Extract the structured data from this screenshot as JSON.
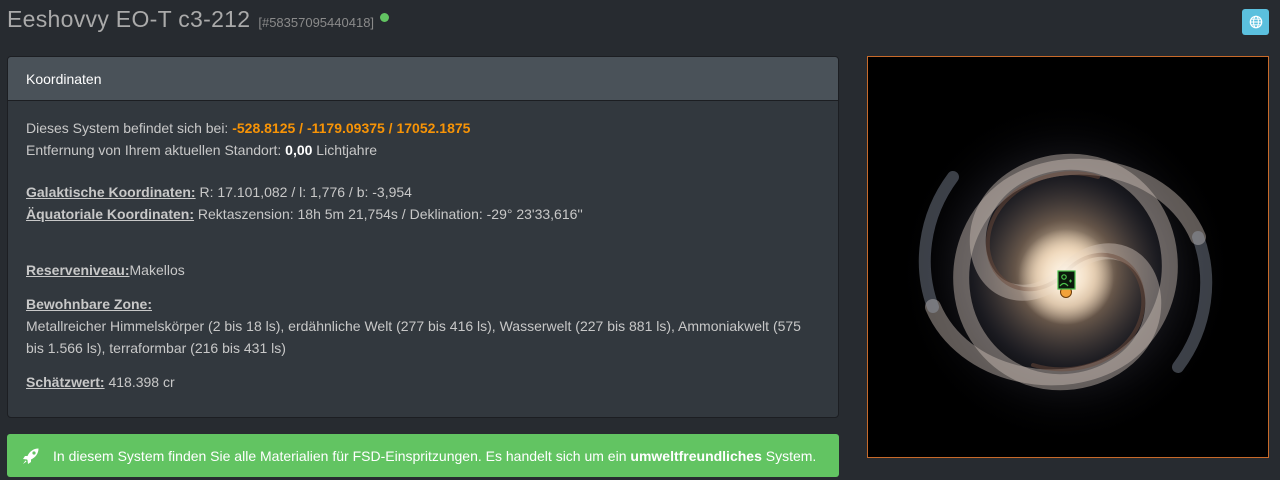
{
  "header": {
    "system_name": "Eeshovvy EO-T c3-212",
    "system_id": "[#58357095440418]",
    "status_color": "#62c462",
    "globe_icon": "globe-icon"
  },
  "panel": {
    "heading": "Koordinaten",
    "location_text": "Dieses System befindet sich bei: ",
    "coordinates": "-528.8125 / -1179.09375 / 17052.1875",
    "distance_prefix": "Entfernung von Ihrem aktuellen Standort: ",
    "distance_value": "0,00",
    "distance_unit": " Lichtjahre",
    "galactic_label": "Galaktische Koordinaten:",
    "galactic_value": " R: 17.101,082 / l: 1,776 / b: -3,954",
    "equatorial_label": "Äquatoriale Koordinaten:",
    "equatorial_value": " Rektaszension: 18h 5m 21,754s / Deklination: -29° 23'33,616''",
    "reserve_label": "Reserveniveau:",
    "reserve_value": "Makellos",
    "habitable_label": "Bewohnbare Zone:",
    "habitable_value": "Metallreicher Himmelskörper (2 bis 18 ls), erdähnliche Welt (277 bis 416 ls), Wasserwelt (227 bis 881 ls), Ammoniakwelt (575 bis 1.566 ls), terraformbar (216 bis 431 ls)",
    "estimate_label": "Schätzwert:",
    "estimate_value": " 418.398 cr"
  },
  "alert": {
    "icon": "rocket-icon",
    "text_before": "In diesem System finden Sie alle Materialien für FSD-Einspritzungen. Es handelt sich um ein ",
    "text_bold": "umweltfreundliches",
    "text_after": " System."
  },
  "map": {
    "image": "galaxy-map",
    "marker_icon": "player-marker-icon",
    "accent_color": "#c86a2a"
  }
}
